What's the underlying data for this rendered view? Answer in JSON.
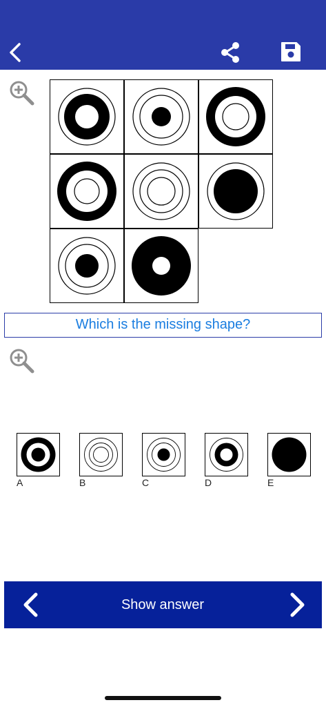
{
  "header": {
    "background": "#2a3ba8",
    "back_icon": "chevron-left-icon",
    "share_icon": "share-icon",
    "save_icon": "floppy-disk-icon"
  },
  "puzzle": {
    "zoom_icon": "zoom-in-icon",
    "cells": [
      {
        "row": 1,
        "col": 1,
        "figure": "outer circle, thick black ring, white center"
      },
      {
        "row": 1,
        "col": 2,
        "figure": "two thin circles, small solid black dot"
      },
      {
        "row": 1,
        "col": 3,
        "figure": "wide thick black ring around thin circle"
      },
      {
        "row": 2,
        "col": 1,
        "figure": "wide thick black ring around thin circle"
      },
      {
        "row": 2,
        "col": 2,
        "figure": "three thin concentric circles"
      },
      {
        "row": 2,
        "col": 3,
        "figure": "outer thin circle, large solid black disc"
      },
      {
        "row": 3,
        "col": 1,
        "figure": "two thin circles, solid black dot"
      },
      {
        "row": 3,
        "col": 2,
        "figure": "large black disc with small white center"
      },
      {
        "row": 3,
        "col": 3,
        "figure": "missing"
      }
    ]
  },
  "question": {
    "text": "Which is the missing shape?",
    "color": "#1a7de0"
  },
  "options": {
    "zoom_icon": "zoom-in-icon",
    "items": [
      {
        "letter": "A",
        "figure": "thick black ring, white gap, black dot"
      },
      {
        "letter": "B",
        "figure": "three thin concentric circles"
      },
      {
        "letter": "C",
        "figure": "two thin circles, solid black dot"
      },
      {
        "letter": "D",
        "figure": "thin circle, thick black ring, white center"
      },
      {
        "letter": "E",
        "figure": "large solid black disc"
      }
    ]
  },
  "footer": {
    "background": "#06219a",
    "show_answer_label": "Show answer",
    "prev_icon": "chevron-left-icon",
    "next_icon": "chevron-right-icon"
  }
}
